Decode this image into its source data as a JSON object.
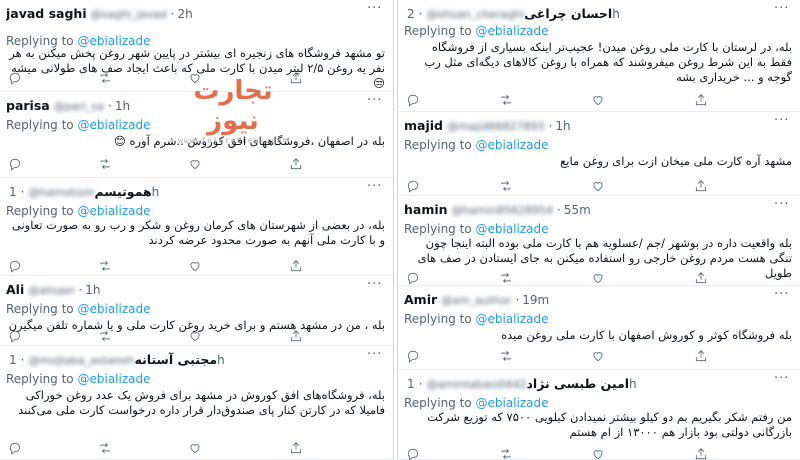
{
  "reply_prefix": "Replying to",
  "watermark": {
    "logo": "تجارت نیوز",
    "url": "www.tejaratnews.com"
  },
  "left": [
    {
      "name": "javad saghi",
      "handle": "@saghi_javad",
      "time": "2h",
      "mention": "@ebializade",
      "text": "تو مشهد فروشگاه های زنجیره ای بیشتر در پایین شهر روغن پخش میکنن به هر نفر یه روغن ۲/۵ لیتر میدن با کارت ملی که باعث ایجاد صف های طولانی میشه 😒"
    },
    {
      "name": "parisa",
      "handle": "@pari_sa",
      "time": "1h",
      "mention": "@ebializade",
      "text": "بله در اصفهان ،فروشگاههای افق کوروش ..شرم آوره 😊"
    },
    {
      "name": "هموتیسم",
      "handle": "@hamotism",
      "time": "1h",
      "mention": "@ebializade",
      "text": "بله، در بعضی از شهرستان های کرمان روغن و شکر و رب رو به صورت تعاونی و با کارت ملی آنهم به صورت محدود عرضه کردند"
    },
    {
      "name": "Ali",
      "handle": "@alisaei",
      "time": "1h",
      "mention": "@ebializade",
      "text": "بله ، من در مشهد هستم و برای خرید روغن کارت ملی و یا شماره تلفن میگیرن"
    },
    {
      "name": "مجتبی آستانه",
      "handle": "@mojtaba_astaneh",
      "time": "1h",
      "mention": "@ebializade",
      "text": "بله، فروشگاه‌های افق کوروش در مشهد برای فروش یک عدد روغن خوراکی فامیلا که در کارتن کنار پای صندوق‌دار قرار داره درخواست کارت ملی می‌کنند"
    }
  ],
  "right": [
    {
      "name": "احسان چراغی",
      "handle": "@ehsan_cheraghi",
      "time": "2h",
      "mention": "@ebializade",
      "text": "بله، در لرستان با کارت ملی روغن میدن! عجیب‌تر اینکه بسیاری از فروشگاه فقط به این شرط روغن میفروشند که همراه با روغن کالاهای دیگه‌ای مثل رب گوجه و ... خریداری بشه"
    },
    {
      "name": "majid",
      "handle": "@majid66827893",
      "time": "1h",
      "mention": "@ebializade",
      "text": "مشهد آره کارت ملی میخان ازت برای روغن مایع"
    },
    {
      "name": "hamin",
      "handle": "@hamin85628954",
      "time": "55m",
      "mention": "@ebializade",
      "text": "بله واقعیت داره در بوشهر /جم /عسلویه هم با کارت ملی بوده البته اینجا چون تنگی هست مردم روغن خارجی رو استفاده میکنن به جای ایستادن در صف های طویل"
    },
    {
      "name": "Amir",
      "handle": "@am_author",
      "time": "19m",
      "mention": "@ebializade",
      "text": "بله فروشگاه کوثر و کوروش اصفهان با کارت ملی روغن میده"
    },
    {
      "name": "امین طبسی نژاد",
      "handle": "@amintabasi0442",
      "time": "1h",
      "mention": "@ebializade",
      "text": "من رفتم شکر بگیریم بم دو کیلو بیشتر نمیدادن کیلویی ۷۵۰۰ که توزیع شرکت بازرگانی دولتی بود بازار هم ۱۳۰۰۰ از ام هستم"
    }
  ],
  "icons": [
    "reply-icon",
    "retweet-icon",
    "like-icon",
    "share-icon",
    "more-icon"
  ]
}
